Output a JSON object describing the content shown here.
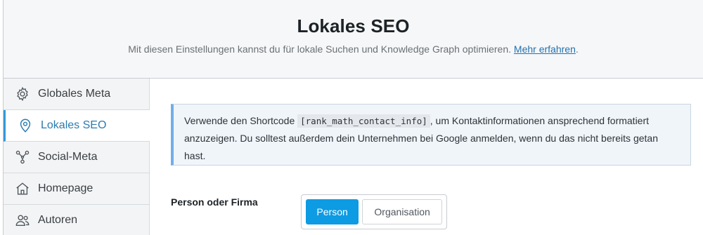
{
  "header": {
    "title": "Lokales SEO",
    "subtitle": "Mit diesen Einstellungen kannst du für lokale Suchen und Knowledge Graph optimieren.",
    "link_label": "Mehr erfahren",
    "trailing": "."
  },
  "sidebar": {
    "items": [
      {
        "label": "Globales Meta",
        "icon": "gear-icon"
      },
      {
        "label": "Lokales SEO",
        "icon": "location-pin-icon",
        "active": true
      },
      {
        "label": "Social-Meta",
        "icon": "share-nodes-icon"
      },
      {
        "label": "Homepage",
        "icon": "home-icon"
      },
      {
        "label": "Autoren",
        "icon": "users-icon"
      }
    ]
  },
  "notice": {
    "text_before": "Verwende den Shortcode ",
    "shortcode": "[rank_math_contact_info]",
    "text_after": ", um Kontaktinformationen ansprechend formatiert anzuzeigen. Du solltest außerdem dein Unternehmen bei Google anmelden, wenn du das nicht bereits getan hast."
  },
  "field": {
    "label": "Person oder Firma",
    "options": [
      "Person",
      "Organisation"
    ],
    "selected": "Person"
  },
  "colors": {
    "accent": "#0d9be3",
    "active_nav_border": "#3398d7",
    "link": "#2271b1"
  }
}
